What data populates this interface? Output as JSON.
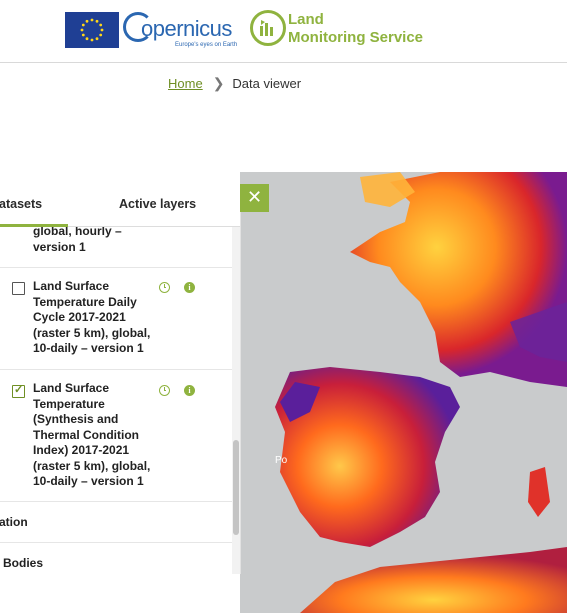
{
  "header": {
    "copernicus_name": "opernicus",
    "copernicus_tagline": "Europe's eyes on Earth",
    "service_title_line1": "Land",
    "service_title_line2": "Monitoring Service"
  },
  "breadcrumb": {
    "home": "Home",
    "separator": "❯",
    "current": "Data viewer"
  },
  "panel": {
    "tabs": [
      {
        "label": "atasets"
      },
      {
        "label": "Active layers"
      }
    ],
    "close_icon": "✕",
    "partial_item": [
      "global, hourly –",
      "version 1"
    ],
    "items": [
      {
        "lines": [
          "Land Surface",
          "Temperature Daily",
          "Cycle 2017-2021",
          "(raster 5 km), global,",
          "10-daily – version 1"
        ],
        "checked": false
      },
      {
        "lines": [
          "Land Surface",
          "Temperature",
          "(Synthesis and",
          "Thermal Condition",
          "Index) 2017-2021",
          "(raster 5 km), global,",
          "10-daily – version 1"
        ],
        "checked": true
      }
    ],
    "categories": [
      {
        "label": "ation"
      },
      {
        "label": "Bodies"
      }
    ],
    "info_glyph": "i",
    "check_glyph": "✓"
  },
  "map": {
    "partial_place_label": "Po"
  },
  "colors": {
    "accent": "#8fb33f",
    "eu_blue": "#1f3f94",
    "copernicus_blue": "#2b67b1"
  }
}
